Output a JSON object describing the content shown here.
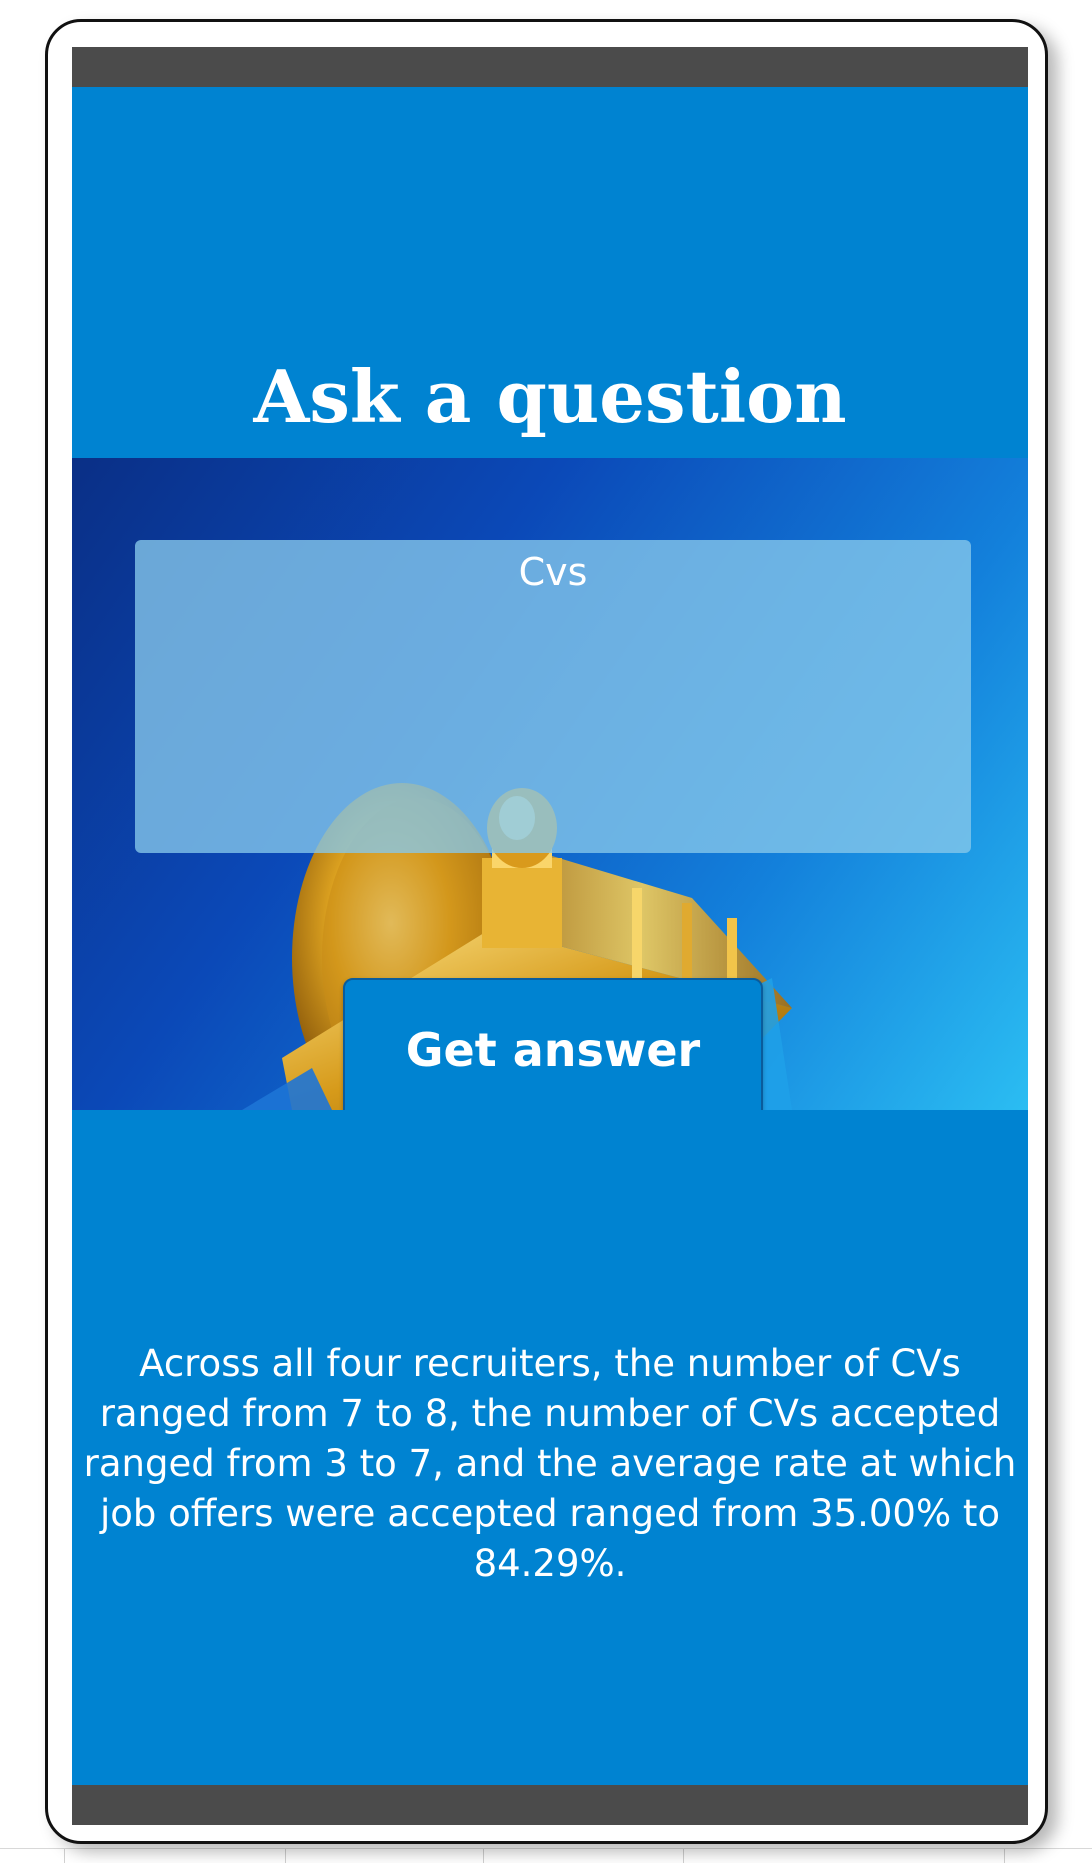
{
  "page": {
    "title": "Ask a question"
  },
  "question": {
    "value": "",
    "placeholder": "Cvs"
  },
  "actions": {
    "get_answer_label": "Get answer"
  },
  "answer": {
    "text": "Across all four recruiters, the number of CVs ranged from 7 to 8, the number of CVs accepted ranged from 3 to 7, and the average rate at which job offers were accepted ranged from 35.00% to 84.29%."
  },
  "colors": {
    "screen_background": "#0083d1",
    "bars": "#4b4b4b",
    "button": "#0083d1",
    "text": "#ffffff"
  },
  "icons": {
    "hero_image": "golden-trophy-in-box-illustration"
  }
}
